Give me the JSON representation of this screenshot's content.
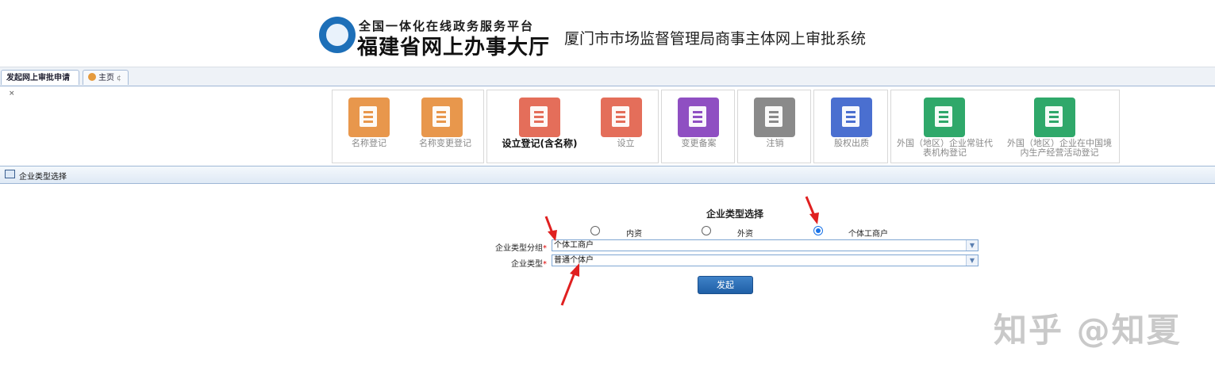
{
  "header": {
    "logo_line1": "全国一体化在线政务服务平台",
    "logo_line2": "福建省网上办事大厅",
    "system_title": "厦门市市场监督管理局商事主体网上审批系统"
  },
  "tabs": [
    {
      "label": "发起网上审批申请",
      "close": "×"
    },
    {
      "label": "主页",
      "close": "¢"
    }
  ],
  "tiles": [
    {
      "label": "名称登记",
      "icon": "name-register-icon",
      "color": "#e8974c"
    },
    {
      "label": "名称变更登记",
      "icon": "name-change-icon",
      "color": "#e8974c"
    },
    {
      "label": "设立登记(含名称)",
      "icon": "establish-with-name-icon",
      "color": "#e46e5a"
    },
    {
      "label": "设立",
      "icon": "establish-icon",
      "color": "#e46e5a"
    },
    {
      "label": "变更备案",
      "icon": "change-filing-icon",
      "color": "#8f4fc2"
    },
    {
      "label": "注销",
      "icon": "cancel-icon",
      "color": "#8a8a8a"
    },
    {
      "label": "股权出质",
      "icon": "equity-pledge-icon",
      "color": "#4a6fd0"
    },
    {
      "label": "外国（地区）企业常驻代表机构登记",
      "icon": "foreign-rep-office-icon",
      "color": "#2fa86a"
    },
    {
      "label": "外国（地区）企业在中国境内生产经营活动登记",
      "icon": "foreign-business-activity-icon",
      "color": "#2fa86a"
    }
  ],
  "section": {
    "title": "企业类型选择"
  },
  "form": {
    "title": "企业类型选择",
    "radios": [
      {
        "label": "内资",
        "checked": false
      },
      {
        "label": "外资",
        "checked": false
      },
      {
        "label": "个体工商户",
        "checked": true
      }
    ],
    "group_label": "企业类型分组",
    "group_value": "个体工商户",
    "type_label": "企业类型",
    "type_value": "普通个体户",
    "required_mark": "*",
    "submit_label": "发起"
  },
  "watermark": "知乎 @知夏",
  "colors": {
    "accent": "#1f5fa6",
    "annotation": "#e02020"
  }
}
